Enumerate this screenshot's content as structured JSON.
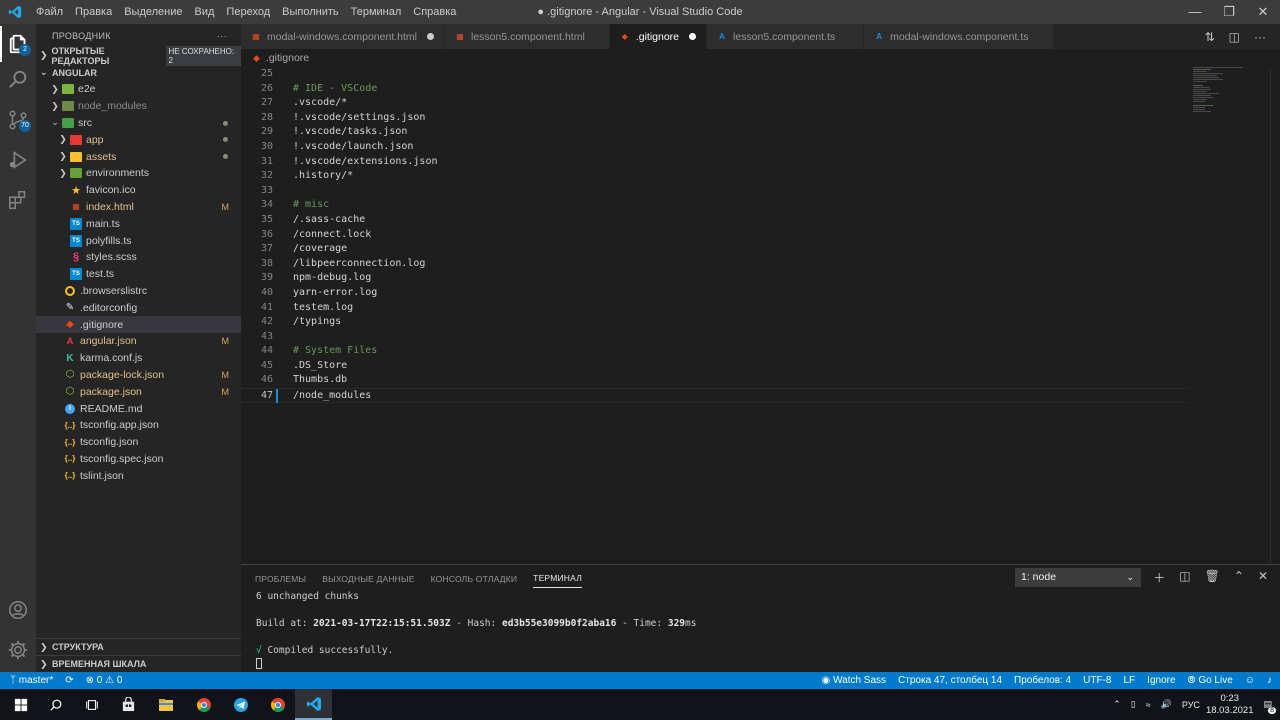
{
  "window": {
    "title": "● .gitignore - Angular - Visual Studio Code",
    "menu": [
      "Файл",
      "Правка",
      "Выделение",
      "Вид",
      "Переход",
      "Выполнить",
      "Терминал",
      "Справка"
    ]
  },
  "activity": {
    "explorer_badge": "2",
    "scm_badge": "70"
  },
  "sidebar": {
    "header": "ПРОВОДНИК",
    "more": "···",
    "open_editors_label": "ОТКРЫТЫЕ РЕДАКТОРЫ",
    "unsaved_badge": "НЕ СОХРАНЕНО: 2",
    "project_label": "ANGULAR",
    "items": [
      {
        "label": "e2e"
      },
      {
        "label": "node_modules"
      },
      {
        "label": "src"
      },
      {
        "label": "app"
      },
      {
        "label": "assets"
      },
      {
        "label": "environments"
      },
      {
        "label": "favicon.ico"
      },
      {
        "label": "index.html",
        "badge": "M"
      },
      {
        "label": "main.ts"
      },
      {
        "label": "polyfills.ts"
      },
      {
        "label": "styles.scss"
      },
      {
        "label": "test.ts"
      },
      {
        "label": ".browserslistrc"
      },
      {
        "label": ".editorconfig"
      },
      {
        "label": ".gitignore"
      },
      {
        "label": "angular.json",
        "badge": "M"
      },
      {
        "label": "karma.conf.js"
      },
      {
        "label": "package-lock.json",
        "badge": "M"
      },
      {
        "label": "package.json",
        "badge": "M"
      },
      {
        "label": "README.md"
      },
      {
        "label": "tsconfig.app.json"
      },
      {
        "label": "tsconfig.json"
      },
      {
        "label": "tsconfig.spec.json"
      },
      {
        "label": "tslint.json"
      }
    ],
    "outline_label": "СТРУКТУРА",
    "timeline_label": "ВРЕМЕННАЯ ШКАЛА"
  },
  "tabs": [
    {
      "label": "modal-windows.component.html"
    },
    {
      "label": "lesson5.component.html"
    },
    {
      "label": ".gitignore"
    },
    {
      "label": "lesson5.component.ts"
    },
    {
      "label": "modal-windows.component.ts"
    }
  ],
  "breadcrumb": ".gitignore",
  "editor": {
    "lines": [
      {
        "n": "25",
        "t": ""
      },
      {
        "n": "26",
        "t": "# IDE - VSCode"
      },
      {
        "n": "27",
        "t": ".vscode/*"
      },
      {
        "n": "28",
        "t": "!.vscode/settings.json"
      },
      {
        "n": "29",
        "t": "!.vscode/tasks.json"
      },
      {
        "n": "30",
        "t": "!.vscode/launch.json"
      },
      {
        "n": "31",
        "t": "!.vscode/extensions.json"
      },
      {
        "n": "32",
        "t": ".history/*"
      },
      {
        "n": "33",
        "t": ""
      },
      {
        "n": "34",
        "t": "# misc"
      },
      {
        "n": "35",
        "t": "/.sass-cache"
      },
      {
        "n": "36",
        "t": "/connect.lock"
      },
      {
        "n": "37",
        "t": "/coverage"
      },
      {
        "n": "38",
        "t": "/libpeerconnection.log"
      },
      {
        "n": "39",
        "t": "npm-debug.log"
      },
      {
        "n": "40",
        "t": "yarn-error.log"
      },
      {
        "n": "41",
        "t": "testem.log"
      },
      {
        "n": "42",
        "t": "/typings"
      },
      {
        "n": "43",
        "t": ""
      },
      {
        "n": "44",
        "t": "# System Files"
      },
      {
        "n": "45",
        "t": ".DS_Store"
      },
      {
        "n": "46",
        "t": "Thumbs.db"
      },
      {
        "n": "47",
        "t": "/node_modules"
      }
    ]
  },
  "panel": {
    "tabs": [
      "ПРОБЛЕМЫ",
      "ВЫХОДНЫЕ ДАННЫЕ",
      "КОНСОЛЬ ОТЛАДКИ",
      "ТЕРМИНАЛ"
    ],
    "terminal_select": "1: node",
    "term_line1": "6 unchanged chunks",
    "build_prefix": "Build at: ",
    "build_date": "2021-03-17T22:15:51.503Z",
    "hash_prefix": " - Hash: ",
    "hash": "ed3b55e3099b0f2aba16",
    "time_prefix": " - Time: ",
    "time_value": "329",
    "time_unit": "ms",
    "check": "√",
    "compiled": " Compiled successfully."
  },
  "status": {
    "branch": "master*",
    "errors": "0",
    "warnings": "0",
    "watch_sass": "Watch Sass",
    "position": "Строка 47, столбец 14",
    "spaces": "Пробелов: 4",
    "encoding": "UTF-8",
    "eol": "LF",
    "language": "Ignore",
    "golive": "Go Live"
  },
  "taskbar": {
    "lang": "РУС",
    "time": "0:23",
    "date": "18.03.2021",
    "notifications": "8"
  }
}
